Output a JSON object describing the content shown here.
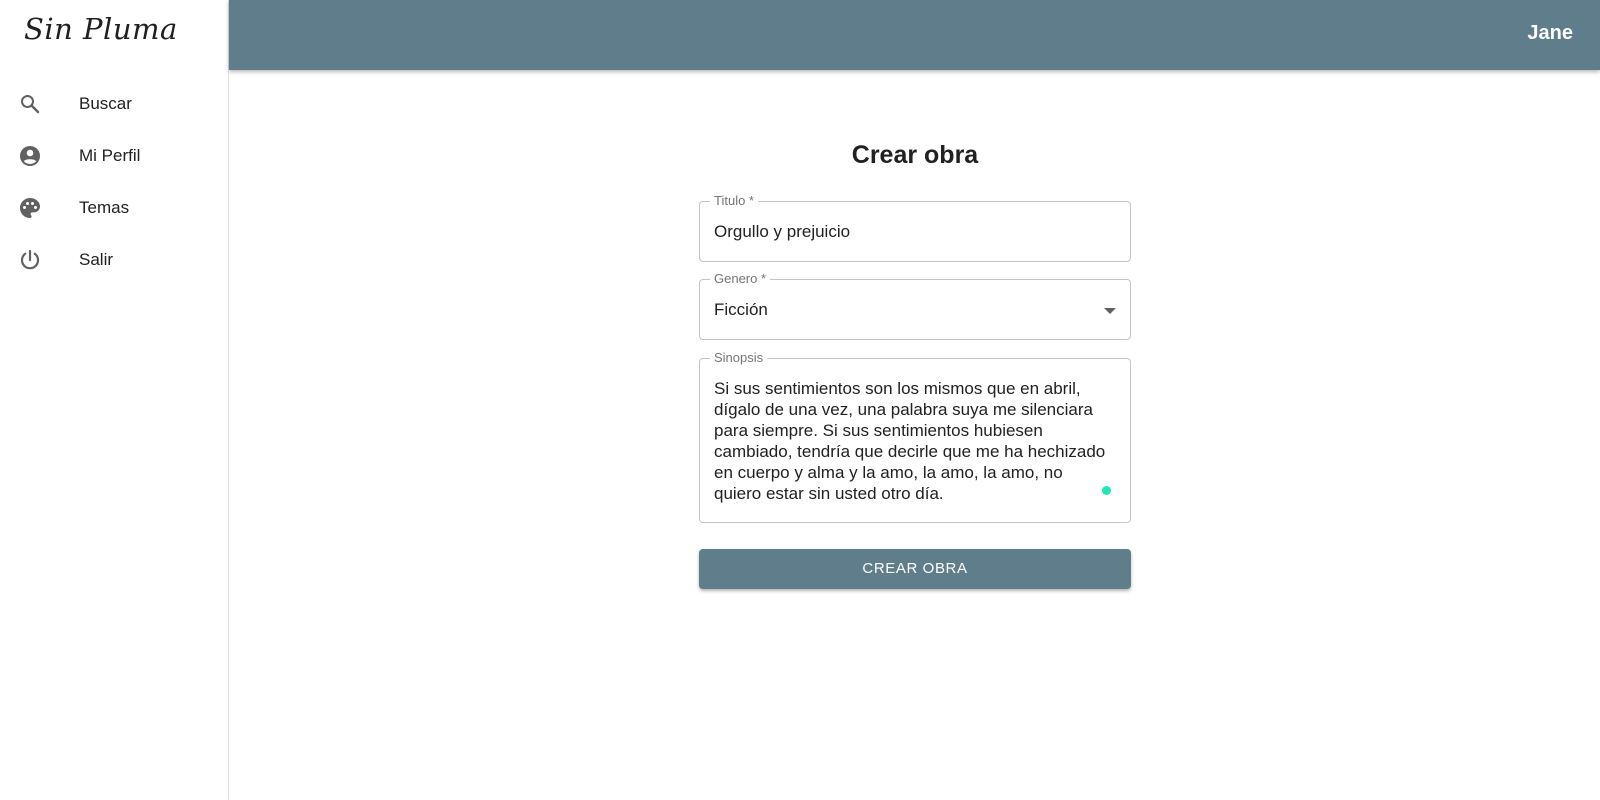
{
  "app": {
    "brand": "Sin Pluma"
  },
  "sidebar": {
    "items": [
      {
        "label": "Buscar",
        "icon": "search-icon"
      },
      {
        "label": "Mi Perfil",
        "icon": "account-circle-icon"
      },
      {
        "label": "Temas",
        "icon": "palette-icon"
      },
      {
        "label": "Salir",
        "icon": "power-icon"
      }
    ]
  },
  "header": {
    "user_name": "Jane",
    "color": "#607d8b"
  },
  "form": {
    "title": "Crear obra",
    "titulo": {
      "label": "Titulo *",
      "value": "Orgullo y prejuicio"
    },
    "genero": {
      "label": "Genero *",
      "value": "Ficción"
    },
    "sinopsis": {
      "label": "Sinopsis",
      "value": "Si sus sentimientos son los mismos que en abril, dígalo de una vez, una palabra suya me silenciara para siempre. Si sus sentimientos hubiesen cambiado, tendría que decirle que me ha hechizado en cuerpo y alma y la amo, la amo, la amo, no quiero estar sin usted otro día."
    },
    "submit_label": "CREAR OBRA"
  },
  "colors": {
    "accent": "#607d8b",
    "status_dot": "#1de9b6"
  }
}
